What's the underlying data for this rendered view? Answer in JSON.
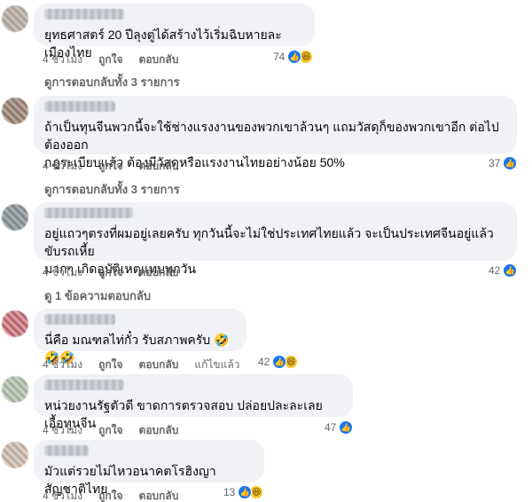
{
  "comments": [
    {
      "text": "ยุทธศาสตร์ 20 ปีลุงตู่ได้สร้างไว้เริ่มฉิบหายละเมืองไทย",
      "time": "4 ชั่วโมง",
      "like_label": "ถูกใจ",
      "reply_label": "ตอบกลับ",
      "reaction_count": "74",
      "reactions": [
        "like-icon",
        "haha-icon"
      ],
      "view_replies": "ดูการตอบกลับทั้ง 3 รายการ"
    },
    {
      "text": "ถ้าเป็นทุนจีนพวกนี้จะใช้ช่างแรงงานของพวกเขาล้วนๆ แถมวัสดุก็ของพวกเขาอีก ต่อไปต้องออก\nกฎระเบียบแล้ว ต้องมีวัสดุหรือแรงงานไทยอย่างน้อย 50%",
      "time": "4 ชั่วโมง",
      "like_label": "ถูกใจ",
      "reply_label": "ตอบกลับ",
      "reaction_count": "37",
      "reactions": [
        "like-icon"
      ],
      "view_replies": "ดูการตอบกลับทั้ง 3 รายการ"
    },
    {
      "text": "อยู่แถวๆตรงที่ผมอยู่เลยครับ ทุกวันนี้จะไม่ใช่ประเทศไทยแล้ว จะเป็นประเทศจีนอยู่แล้ว ขับรถเหี้ย\nมากๆ เกิดอุบัติเหตุแทบทุกวัน",
      "time": "4 ชั่วโมง",
      "like_label": "ถูกใจ",
      "reply_label": "ตอบกลับ",
      "reaction_count": "42",
      "reactions": [
        "like-icon"
      ],
      "view_replies": "ดู 1 ข้อความตอบกลับ"
    },
    {
      "text": "นี่คือ มณฑลไท่กั๋ว รับสภาพครับ 🤣🤣🤣",
      "time": "4 ชั่วโมง",
      "like_label": "ถูกใจ",
      "reply_label": "ตอบกลับ",
      "edited_label": "แก้ไขแล้ว",
      "reaction_count": "42",
      "reactions": [
        "like-icon",
        "haha-icon"
      ]
    },
    {
      "text": "หน่วยงานรัฐตัวดี ขาดการตรวจสอบ ปล่อยปละละเลย เอื้อทุนจีน",
      "time": "4 ชั่วโมง",
      "like_label": "ถูกใจ",
      "reply_label": "ตอบกลับ",
      "reaction_count": "47",
      "reactions": [
        "like-icon"
      ]
    },
    {
      "text": "มัวแต่รวยไม่ไหวอนาคตโรฮิงญาสัญชาติไทย",
      "time": "4 ชั่วโมง",
      "like_label": "ถูกใจ",
      "reply_label": "ตอบกลับ",
      "reaction_count": "13",
      "reactions": [
        "like-icon",
        "haha-icon"
      ]
    }
  ],
  "colors": {
    "bubble": "#f0f2f5",
    "meta_text": "#65676b",
    "like_blue": "#1877f2",
    "haha_yellow": "#f7c730"
  }
}
